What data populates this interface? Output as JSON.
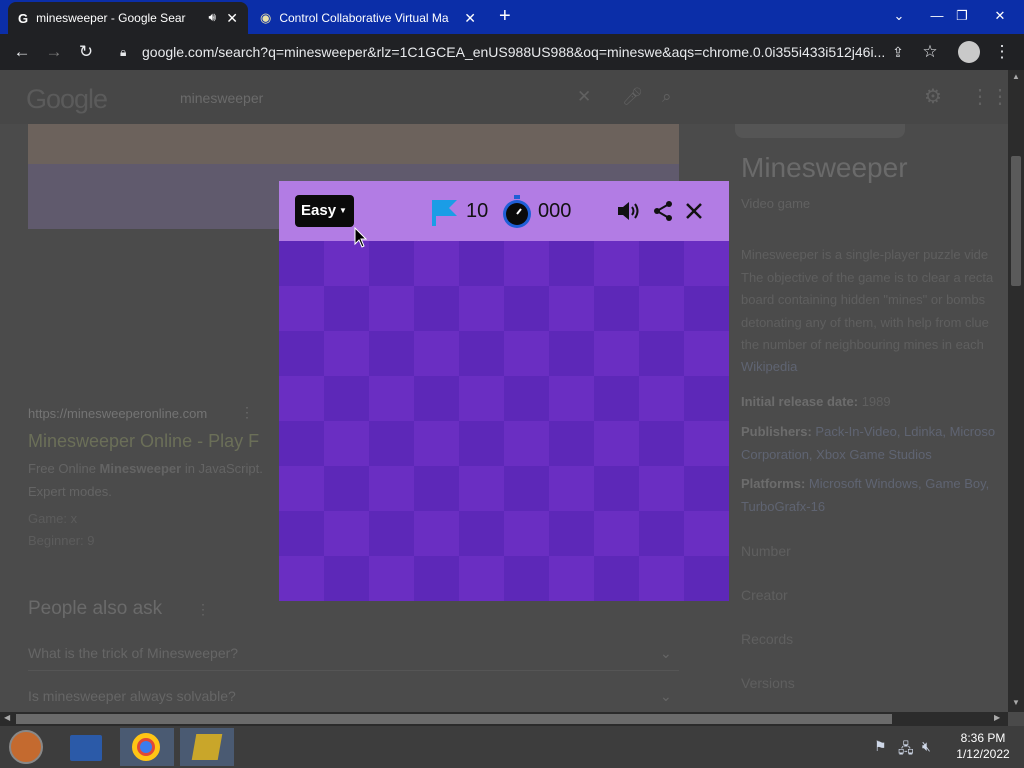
{
  "browser": {
    "tabs": [
      {
        "title": "minesweeper - Google Search",
        "active": true,
        "audio": true
      },
      {
        "title": "Control Collaborative Virtual Ma",
        "active": false
      }
    ],
    "new_tab": "+",
    "url": "google.com/search?q=minesweeper&rlz=1C1GCEA_enUS988US988&oq=mineswe&aqs=chrome.0.0i355i433i512j46i..."
  },
  "google": {
    "logo": "Google",
    "query": "minesweeper"
  },
  "results": {
    "url": "https://minesweeperonline.com",
    "title": "Minesweeper Online - Play F",
    "snippet_prefix": "Free Online ",
    "snippet_bold": "Minesweeper",
    "snippet_suffix": " in JavaScript.",
    "snippet_line2": "Expert modes.",
    "game_line": "Game: x",
    "beginner_line": "Beginner: 9"
  },
  "people_also_ask": {
    "heading": "People also ask",
    "questions": [
      "What is the trick of Minesweeper?",
      "Is minesweeper always solvable?"
    ]
  },
  "knowledge_panel": {
    "title": "Minesweeper",
    "subtitle": "Video game",
    "description": [
      "Minesweeper is a single-player puzzle vide",
      "The objective of the game is to clear a recta",
      "board containing hidden \"mines\" or bombs",
      "detonating any of them, with help from clue",
      "the number of neighbouring mines in each"
    ],
    "source": "Wikipedia",
    "release_label": "Initial release date:",
    "release_value": "1989",
    "publishers_label": "Publishers:",
    "publishers_value_1": "Pack-In-Video, Ldinka, Microso",
    "publishers_value_2": "Corporation, Xbox Game Studios",
    "platforms_label": "Platforms:",
    "platforms_value_1": "Microsoft Windows, Game Boy,",
    "platforms_value_2": "TurboGrafx-16",
    "sections": [
      "Number",
      "Creator",
      "Records",
      "Versions"
    ]
  },
  "game": {
    "difficulty": "Easy",
    "flags": "10",
    "timer": "000",
    "colors": {
      "header": "#b27ce4",
      "cell_light": "#6a2ec2",
      "cell_dark": "#5d28b8",
      "flag": "#1a9de6",
      "timer_ring": "#1f5fd6"
    },
    "rows": 8,
    "cols": 10
  },
  "taskbar": {
    "time": "8:36 PM",
    "date": "1/12/2022"
  }
}
